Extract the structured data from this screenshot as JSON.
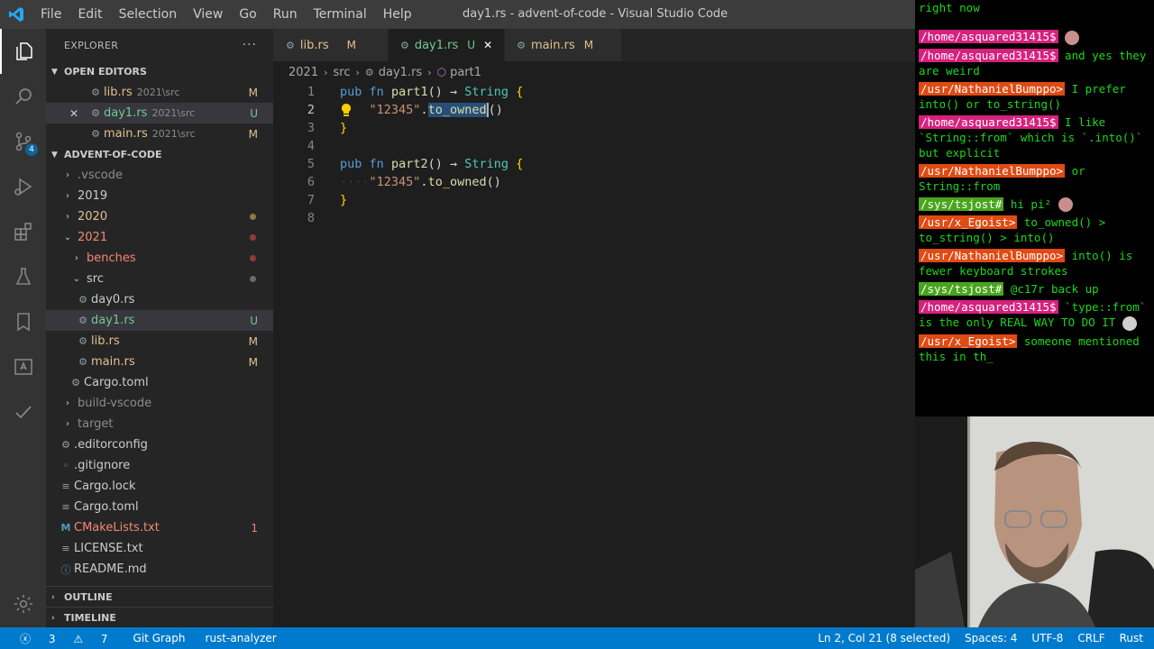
{
  "titlebar": {
    "menu": [
      "File",
      "Edit",
      "Selection",
      "View",
      "Go",
      "Run",
      "Terminal",
      "Help"
    ],
    "title": "day1.rs - advent-of-code - Visual Studio Code"
  },
  "activity": {
    "scm_badge": "4"
  },
  "explorer": {
    "header": "EXPLORER",
    "open_editors_label": "OPEN EDITORS",
    "open_editors": [
      {
        "name": "lib.rs",
        "path": "2021\\src",
        "status": "M"
      },
      {
        "name": "day1.rs",
        "path": "2021\\src",
        "status": "U"
      },
      {
        "name": "main.rs",
        "path": "2021\\src",
        "status": "M"
      }
    ],
    "project_label": "ADVENT-OF-CODE",
    "tree": [
      {
        "name": ".vscode"
      },
      {
        "name": "2019"
      },
      {
        "name": "2020"
      },
      {
        "name": "2021"
      },
      {
        "name": "benches"
      },
      {
        "name": "src"
      },
      {
        "name": "day0.rs"
      },
      {
        "name": "day1.rs",
        "status": "U"
      },
      {
        "name": "lib.rs",
        "status": "M"
      },
      {
        "name": "main.rs",
        "status": "M"
      },
      {
        "name": "Cargo.toml"
      },
      {
        "name": "build-vscode"
      },
      {
        "name": "target"
      },
      {
        "name": ".editorconfig"
      },
      {
        "name": ".gitignore"
      },
      {
        "name": "Cargo.lock"
      },
      {
        "name": "Cargo.toml"
      },
      {
        "name": "CMakeLists.txt",
        "status": "1"
      },
      {
        "name": "LICENSE.txt"
      },
      {
        "name": "README.md"
      }
    ],
    "outline_label": "OUTLINE",
    "timeline_label": "TIMELINE"
  },
  "tabs": [
    {
      "name": "lib.rs",
      "status": "M"
    },
    {
      "name": "day1.rs",
      "status": "U",
      "close": "✕"
    },
    {
      "name": "main.rs",
      "status": "M"
    }
  ],
  "breadcrumb": [
    "2021",
    "src",
    "day1.rs",
    "part1"
  ],
  "code": {
    "line_numbers": [
      "1",
      "2",
      "3",
      "4",
      "5",
      "6",
      "7",
      "8"
    ],
    "pub": "pub",
    "fn": "fn",
    "part1": "part1",
    "part2": "part2",
    "parens": "()",
    "arrow": "→",
    "string": "String",
    "brace_open": "{",
    "brace_close": "}",
    "str_lit": "\"12345\"",
    "dot": ".",
    "to_owned": "to_owned",
    "call": "()",
    "indent": "····"
  },
  "statusbar": {
    "errors": "3",
    "warnings": "7",
    "git_graph": "Git Graph",
    "analyzer": "rust-analyzer",
    "position": "Ln 2, Col 21 (8 selected)",
    "spaces": "Spaces: 4",
    "encoding": "UTF-8",
    "eol": "CRLF",
    "language": "Rust"
  },
  "chat": [
    {
      "text": "right now"
    },
    {
      "user": "/home/asquared31415$",
      "color": "pink",
      "text": ""
    },
    {
      "user": "/home/asquared31415$",
      "color": "pink",
      "text": "and yes they are weird"
    },
    {
      "user": "/usr/NathanielBumppo>",
      "color": "red",
      "text": "I prefer into() or to_string()"
    },
    {
      "user": "/home/asquared31415$",
      "color": "pink",
      "text": "I like `String::from` which is `.into()` but explicit"
    },
    {
      "user": "/usr/NathanielBumppo>",
      "color": "red",
      "text": "or String::from"
    },
    {
      "user": "/sys/tsjost#",
      "color": "green",
      "text": "hi pi²"
    },
    {
      "user": "/usr/x_Egoist>",
      "color": "red",
      "text": "to_owned() > to_string() > into()"
    },
    {
      "user": "/usr/NathanielBumppo>",
      "color": "red",
      "text": "into() is fewer keyboard strokes"
    },
    {
      "user": "/sys/tsjost#",
      "color": "green",
      "text": "@c17r back up"
    },
    {
      "user": "/home/asquared31415$",
      "color": "pink",
      "text": "`type::from` is the only REAL WAY TO DO IT"
    },
    {
      "user": "/usr/x_Egoist>",
      "color": "red",
      "text": "someone mentioned this in th_"
    }
  ]
}
